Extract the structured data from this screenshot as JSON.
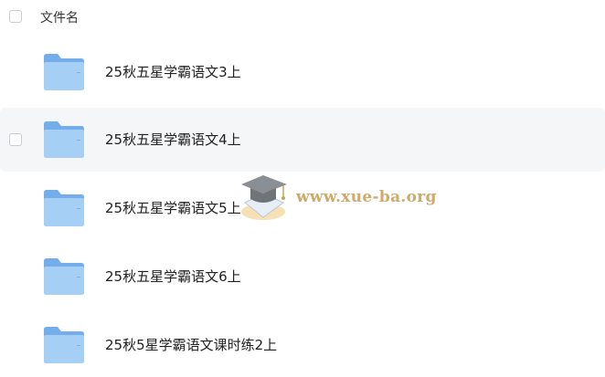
{
  "header": {
    "column_label": "文件名"
  },
  "files": [
    {
      "name": "25秋五星学霸语文3上",
      "type_icon": "folder-icon"
    },
    {
      "name": "25秋五星学霸语文4上",
      "type_icon": "folder-icon"
    },
    {
      "name": "25秋五星学霸语文5上",
      "type_icon": "folder-icon"
    },
    {
      "name": "25秋五星学霸语文6上",
      "type_icon": "folder-icon"
    },
    {
      "name": "25秋5星学霸语文课时练2上",
      "type_icon": "folder-icon"
    }
  ],
  "watermark": {
    "text": "www.xue-ba.org",
    "icon": "graduation-cap-icon"
  },
  "colors": {
    "folder_back": "#7fb6ef",
    "folder_front": "#a9d1f7",
    "row_hover": "#f5f6f7"
  }
}
